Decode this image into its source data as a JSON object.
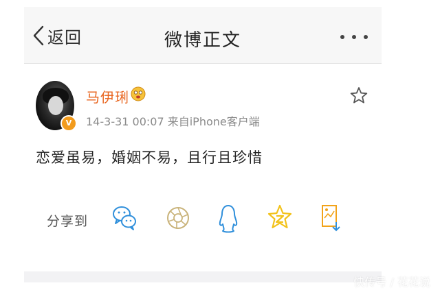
{
  "nav": {
    "back_label": "返回",
    "title": "微博正文"
  },
  "post": {
    "username": "马伊琍",
    "avatar_badge": "V",
    "meta": "14-3-31 00:07  来自iPhone客户端",
    "text": "恋爱虽易，婚姻不易，且行且珍惜"
  },
  "share": {
    "label": "分享到",
    "targets": [
      "wechat-icon",
      "moments-icon",
      "qq-icon",
      "qzone-icon",
      "save-image-icon"
    ]
  },
  "watermark": "快传号 / 花花说",
  "colors": {
    "username": "#e8631c",
    "accent_icon": "#2f8fdb",
    "qzone": "#f2c21a",
    "badge": "#f29b1d"
  }
}
